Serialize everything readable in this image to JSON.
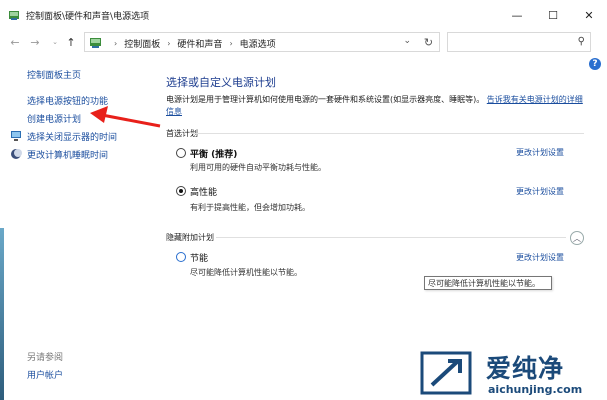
{
  "window": {
    "title": "控制面板\\硬件和声音\\电源选项",
    "minimize": "—",
    "maximize": "☐",
    "close": "✕"
  },
  "address": {
    "crumbs": [
      "控制面板",
      "硬件和声音",
      "电源选项"
    ],
    "search_placeholder": ""
  },
  "sidebar": {
    "items": [
      {
        "label": "控制面板主页"
      },
      {
        "label": "选择电源按钮的功能"
      },
      {
        "label": "创建电源计划"
      },
      {
        "label": "选择关闭显示器的时间"
      },
      {
        "label": "更改计算机睡眠时间"
      }
    ],
    "see_also": "另请参阅",
    "user_accounts": "用户帐户"
  },
  "main": {
    "heading": "选择或自定义电源计划",
    "description": "电源计划是用于管理计算机如何使用电源的一套硬件和系统设置(如显示器亮度、睡眠等)。",
    "description_link": "告诉我有关电源计划的详细信息",
    "preferred_group": "首选计划",
    "hidden_group": "隐藏附加计划",
    "plans": [
      {
        "name": "平衡 (推荐)",
        "desc": "利用可用的硬件自动平衡功耗与性能。",
        "change": "更改计划设置",
        "selected": false
      },
      {
        "name": "高性能",
        "desc": "有利于提高性能，但会增加功耗。",
        "change": "更改计划设置",
        "selected": true
      },
      {
        "name": "节能",
        "desc": "尽可能降低计算机性能以节能。",
        "change": "更改计划设置",
        "selected": false
      }
    ],
    "tooltip": "尽可能降低计算机性能以节能。"
  },
  "watermark": {
    "cn": "爱纯净",
    "url": "aichunjing.com"
  },
  "colors": {
    "link": "#1a4d9e",
    "heading": "#1d3d8f",
    "arrow": "#e8201a",
    "help": "#2a6fcf"
  }
}
